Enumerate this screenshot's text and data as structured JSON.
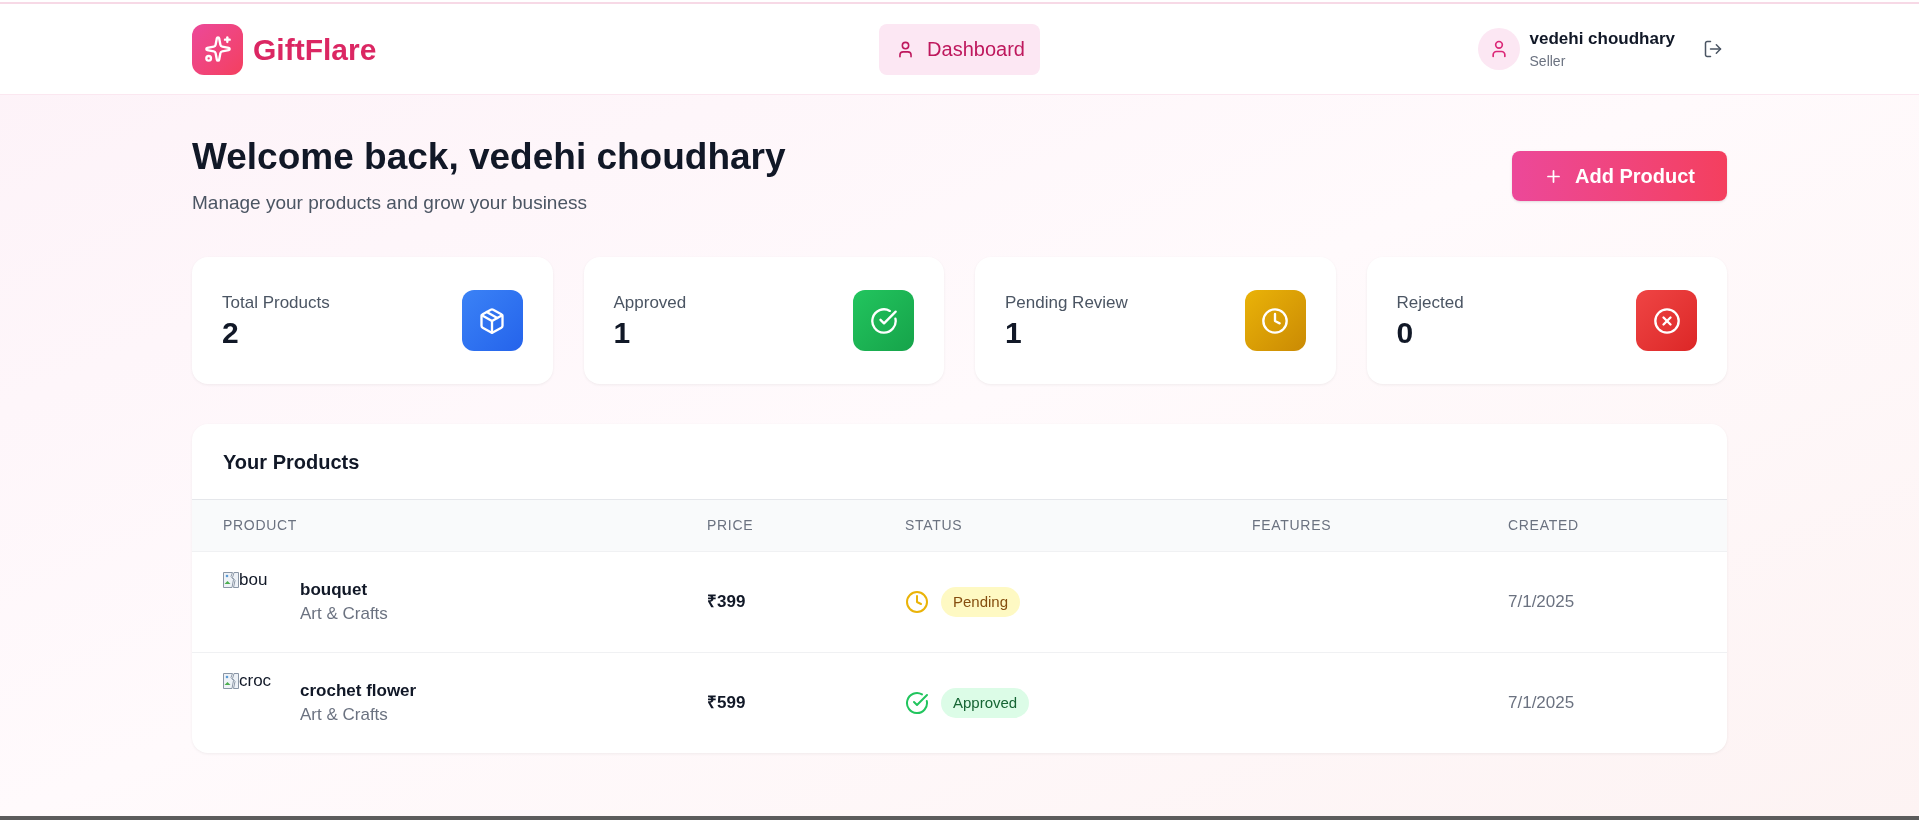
{
  "header": {
    "logo": "GiftFlare",
    "nav": [
      {
        "label": "Dashboard",
        "selected": true
      }
    ],
    "user": {
      "name": "vedehi choudhary",
      "role": "Seller"
    }
  },
  "welcome": {
    "title": "Welcome back, vedehi choudhary",
    "subtitle": "Manage your products and grow your business",
    "add_button": "Add Product"
  },
  "stats": [
    {
      "label": "Total Products",
      "value": "2",
      "kind": "total"
    },
    {
      "label": "Approved",
      "value": "1",
      "kind": "approved"
    },
    {
      "label": "Pending Review",
      "value": "1",
      "kind": "pending"
    },
    {
      "label": "Rejected",
      "value": "0",
      "kind": "rejected"
    }
  ],
  "products": {
    "title": "Your Products",
    "columns": [
      "PRODUCT",
      "PRICE",
      "STATUS",
      "FEATURES",
      "CREATED"
    ],
    "rows": [
      {
        "image_alt": "bou",
        "name": "bouquet",
        "category": "Art & Crafts",
        "price": "₹399",
        "status": {
          "kind": "pending",
          "label": "Pending"
        },
        "created": "7/1/2025"
      },
      {
        "image_alt": "croc",
        "name": "crochet flower",
        "category": "Art & Crafts",
        "price": "₹599",
        "status": {
          "kind": "approved",
          "label": "Approved"
        },
        "created": "7/1/2025"
      }
    ]
  }
}
